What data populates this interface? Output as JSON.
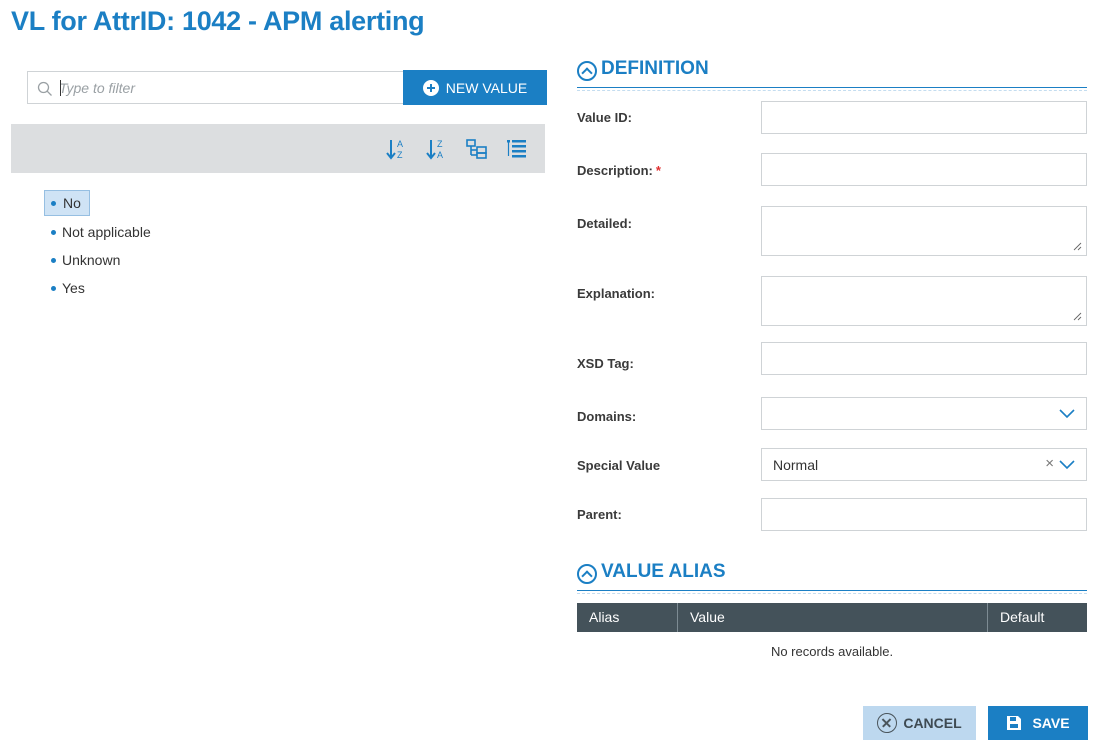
{
  "page": {
    "title": "VL for AttrID: 1042 - APM alerting"
  },
  "filter": {
    "placeholder": "Type to filter",
    "value": ""
  },
  "new_value_button": {
    "label": "NEW VALUE",
    "icon": "plus-circle-icon"
  },
  "toolbar": {
    "buttons": [
      {
        "icon": "sort-ascending-icon"
      },
      {
        "icon": "sort-descending-icon"
      },
      {
        "icon": "tree-view-icon"
      },
      {
        "icon": "list-view-icon"
      }
    ]
  },
  "tree": {
    "items": [
      {
        "label": "No",
        "selected": true
      },
      {
        "label": "Not applicable",
        "selected": false
      },
      {
        "label": "Unknown",
        "selected": false
      },
      {
        "label": "Yes",
        "selected": false
      }
    ]
  },
  "definition": {
    "title": "DEFINITION",
    "fields": {
      "value_id": {
        "label": "Value ID:",
        "value": ""
      },
      "description": {
        "label": "Description:",
        "required_mark": "*",
        "value": ""
      },
      "detailed": {
        "label": "Detailed:",
        "value": ""
      },
      "explanation": {
        "label": "Explanation:",
        "value": ""
      },
      "xsd_tag": {
        "label": "XSD Tag:",
        "value": ""
      },
      "domains": {
        "label": "Domains:",
        "value": ""
      },
      "special_value": {
        "label": "Special Value",
        "value": "Normal",
        "clear_glyph": "×"
      },
      "parent": {
        "label": "Parent:",
        "value": ""
      }
    }
  },
  "value_alias": {
    "title": "VALUE ALIAS",
    "columns": [
      "Alias",
      "Value",
      "Default"
    ],
    "rows": [],
    "empty_message": "No records available."
  },
  "actions": {
    "cancel_label": "CANCEL",
    "save_label": "SAVE"
  },
  "colors": {
    "accent": "#1b7fc4",
    "grid_header": "#44525a",
    "toolbar_bg": "#dcdee0",
    "selected_bg": "#cfe3f5",
    "cancel_bg": "#bdd8ef"
  }
}
